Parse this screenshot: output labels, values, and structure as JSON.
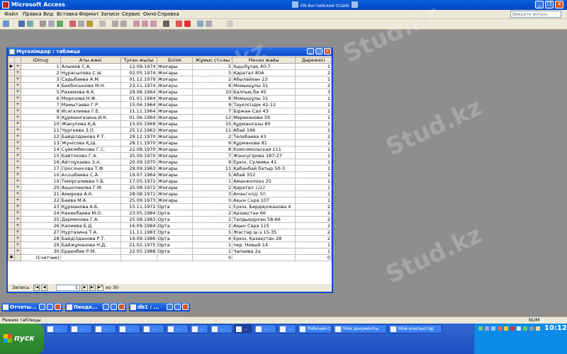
{
  "app": {
    "title": "Microsoft Access",
    "lang": "EN Английский (США)"
  },
  "menu": [
    "Файл",
    "Правка",
    "Вид",
    "Вставка",
    "Формат",
    "Записи",
    "Сервис",
    "Окно",
    "Справка"
  ],
  "help_placeholder": "Введите вопрос",
  "table_window": {
    "title": "Мұғалімдер : таблица",
    "columns": [
      "IDmug",
      "Аты-жөні",
      "Туған жылы",
      "Білімі",
      "Жұмыс стажы",
      "Мекен жайы",
      "Дәрежесі"
    ],
    "rows": [
      [
        "1",
        "Алымов С.А.",
        "12.09.1974",
        "Жоғары",
        "5",
        "Ащыбұлақ 40-7",
        "1"
      ],
      [
        "2",
        "Нұрасылова С.Ы.",
        "02.05.1974",
        "Жоғары",
        "5",
        "Қаратал 80А",
        "2"
      ],
      [
        "3",
        "Садыбаева А.М.",
        "01.12.1979",
        "Жоғары",
        "2",
        "Абылайхан 23",
        "1"
      ],
      [
        "4",
        "Бекбосынова М.Н.",
        "23.11.1974",
        "Жоғары",
        "8",
        "Момышұлы 31",
        "2"
      ],
      [
        "5",
        "Рахимова А.К.",
        "29.08.1964",
        "Жоғары",
        "10",
        "Балпық би 45",
        "3"
      ],
      [
        "6",
        "Морозова Н.Ф.",
        "01.01.1964",
        "Жоғары",
        "8",
        "Момышұлы 31",
        "1"
      ],
      [
        "7",
        "Мамытаева Г.Р.",
        "15.06.1964",
        "Жоғары",
        "9",
        "Тәуелсіздік 42-12",
        "1"
      ],
      [
        "8",
        "Исагалиева Г.Е.",
        "11.11.1964",
        "Жоғары",
        "7",
        "Біржан Сал 43",
        "1"
      ],
      [
        "9",
        "Құрманғазина И.К.",
        "01.06.1964",
        "Жоғары",
        "12",
        "Мерекенова 59",
        "1"
      ],
      [
        "10",
        "Жакупова Қ.А.",
        "15.05.1969",
        "Жоғары",
        "15",
        "Құрманғазы 60",
        "1"
      ],
      [
        "11",
        "Чургеева З.О.",
        "25.12.1963",
        "Жоғары",
        "11",
        "Абай 196",
        "1"
      ],
      [
        "12",
        "Байділданова Р.Т.",
        "29.12.1970",
        "Жоғары",
        "2",
        "Телебаева 43",
        "2"
      ],
      [
        "13",
        "Жүнісова Қ.Ш.",
        "28.11.1970",
        "Жоғары",
        "9",
        "Құрманова 81",
        "1"
      ],
      [
        "14",
        "Сүйкімбекова Г.С.",
        "22.08.1970",
        "Жоғары",
        "8",
        "Комсомольская 111",
        "1"
      ],
      [
        "15",
        "Байтокова Г.А.",
        "25.09.1970",
        "Жоғары",
        "7",
        "Жансугірова 187-27",
        "1"
      ],
      [
        "16",
        "Айтмұхаева З.А.",
        "20.09.1970",
        "Жоғары",
        "9",
        "Еркін, Сүлеева 41",
        "1"
      ],
      [
        "17",
        "Просяникова Т.Ф.",
        "29.09.1963",
        "Жоғары",
        "11",
        "Қабанбай батыр 50-3",
        "1"
      ],
      [
        "18",
        "Ахашбаева С.А.",
        "19.07.1964",
        "Жоғары",
        "5",
        "Абай 352",
        "1"
      ],
      [
        "19",
        "Теміргалиева Ү.Б.",
        "17.05.1972",
        "Жоғары",
        "1",
        "Аманжолова 25",
        "1"
      ],
      [
        "20",
        "Ақшолақова Г.М.",
        "25.08.1972",
        "Жоғары",
        "2",
        "Қаратал 1/22",
        "1"
      ],
      [
        "21",
        "Амирова А.К.",
        "28.08.1972",
        "Жоғары",
        "3",
        "Амангелді 50",
        "1"
      ],
      [
        "22",
        "Баева М.А.",
        "25.09.1973",
        "Жоғары",
        "9",
        "Ақын Сара 107",
        "1"
      ],
      [
        "23",
        "Құрманова А.Б.",
        "15.11.1972",
        "Орта",
        "1",
        "Еркін, Бердіқожанова 4",
        "2"
      ],
      [
        "24",
        "Кенекбаева М.О.",
        "23.05.1984",
        "Орта",
        "2",
        "Қазақстан 66",
        "2"
      ],
      [
        "25",
        "Дарменова Г.А.",
        "25.08.1983",
        "Орта",
        "2",
        "Талдықорған 58-66",
        "2"
      ],
      [
        "26",
        "Калиева Б.Д.",
        "16.09.1984",
        "Орта",
        "2",
        "Ақын Сара 115",
        "2"
      ],
      [
        "27",
        "Нуртазина Т.А.",
        "11.11.1983",
        "Орта",
        "5",
        "Жастар ш-з 15-35",
        "2"
      ],
      [
        "28",
        "Байділданова Р.Т.",
        "19.09.1986",
        "Орта",
        "4",
        "Еркін, Қазақстан 28",
        "2"
      ],
      [
        "29",
        "Байжұманова Н.Д.",
        "21.02.1975",
        "Орта",
        "1",
        "пер. Новый 14",
        "1"
      ],
      [
        "30",
        "Ерденбек Р.М.",
        "22.05.1988",
        "Орта",
        "1",
        "Чапаева 2а",
        "1"
      ]
    ],
    "new_row": {
      "id": "(Счетчик)",
      "stazh": "0",
      "dar": "0"
    },
    "nav": {
      "label": "Запись:",
      "current": "1",
      "of_label": "из 30"
    }
  },
  "min_windows": [
    "Отчеты...",
    "Пенде...",
    "db1 : ..."
  ],
  "status": {
    "mode": "Режим таблицы",
    "num": "NUM"
  },
  "taskbar": {
    "start": "пуск",
    "items": [
      "...",
      "...",
      "...",
      "...",
      "...",
      "...",
      "...",
      "...",
      "...",
      "...",
      "...",
      "Рабочий стол",
      "Мои документы",
      "Мой компьютер"
    ],
    "clock": "10:12"
  },
  "watermark": "Stud.kz"
}
